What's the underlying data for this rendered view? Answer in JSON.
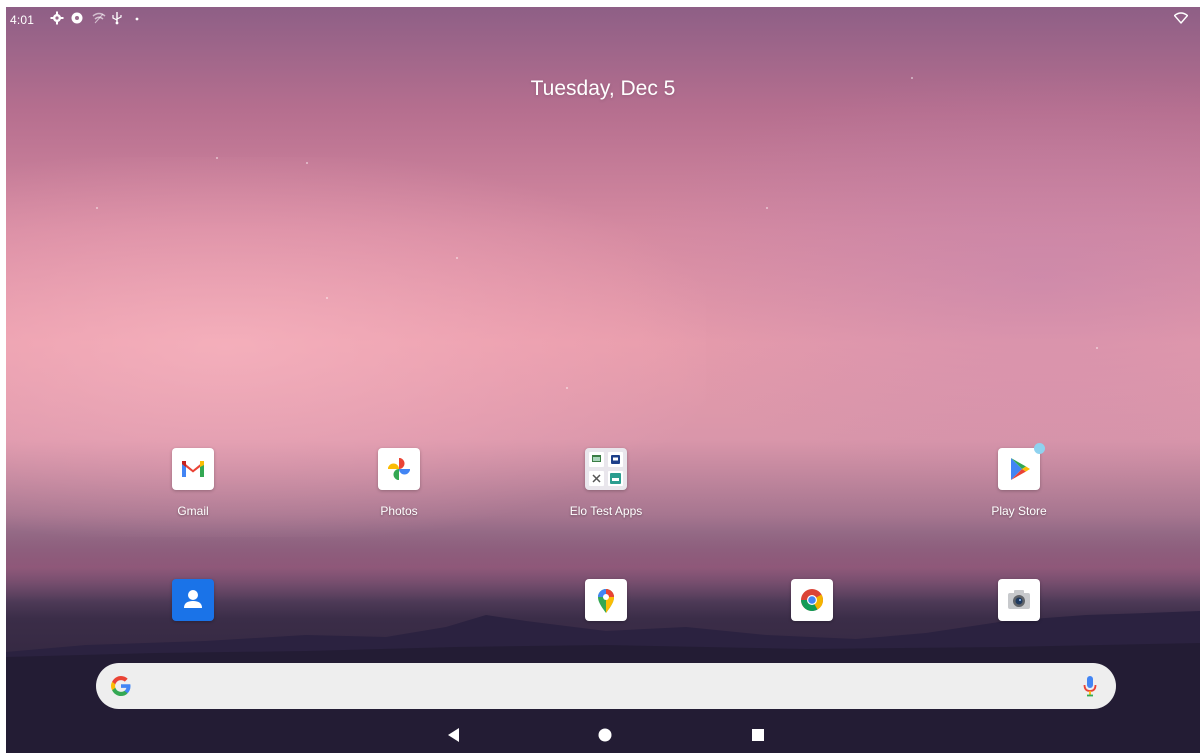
{
  "status_bar": {
    "time": "4:01",
    "icons": [
      "settings-icon",
      "shield-icon",
      "network-icon",
      "usb-icon",
      "dot-icon"
    ],
    "wifi": "wifi-icon"
  },
  "date_widget": {
    "text": "Tuesday, Dec 5"
  },
  "apps_row": [
    {
      "label": "Gmail",
      "icon": "gmail-icon"
    },
    {
      "label": "Photos",
      "icon": "photos-icon"
    },
    {
      "label": "Elo Test Apps",
      "icon": "folder-icon"
    },
    {
      "label": "Play Store",
      "icon": "play-store-icon"
    }
  ],
  "dock": [
    {
      "icon": "contacts-icon"
    },
    {
      "icon": "maps-icon"
    },
    {
      "icon": "chrome-icon"
    },
    {
      "icon": "camera-icon"
    }
  ],
  "search_bar": {
    "logo": "google-logo-icon",
    "placeholder": "",
    "mic": "mic-icon"
  },
  "nav_bar": {
    "buttons": [
      "back-button",
      "home-button",
      "recents-button"
    ]
  },
  "colors": {
    "sky_top": "#8e5f86",
    "sky_mid": "#e79cab",
    "ground": "#271f36",
    "search_bg": "#eeeeee",
    "google_blue": "#4285F4",
    "google_red": "#EA4335",
    "google_yellow": "#FBBC05",
    "google_green": "#34A853",
    "contacts_blue": "#1a73e8",
    "play_badge": "#8fd2ef"
  }
}
